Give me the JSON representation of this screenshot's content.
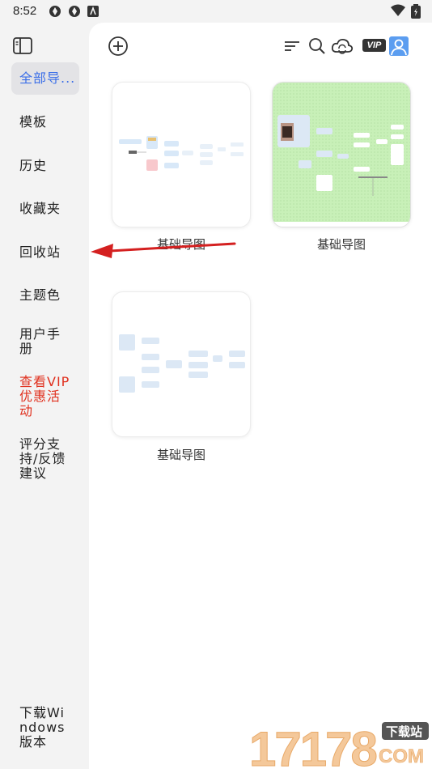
{
  "status": {
    "time": "8:52"
  },
  "sidebar": {
    "items": [
      {
        "label": "全部导...",
        "active": true
      },
      {
        "label": "模板"
      },
      {
        "label": "历史"
      },
      {
        "label": "收藏夹"
      },
      {
        "label": "回收站"
      },
      {
        "label": "主题色"
      },
      {
        "label": "用户手册"
      },
      {
        "label": "查看VIP优惠活动"
      },
      {
        "label": "评分支持/反馈建议"
      },
      {
        "label": "下载Windows版本"
      }
    ]
  },
  "toolbar": {
    "vip_label": "VIP"
  },
  "cards": [
    {
      "title": "基础导图"
    },
    {
      "title": "基础导图"
    },
    {
      "title": "基础导图"
    }
  ],
  "watermark": {
    "digits": "17178",
    "badge": "下载站",
    "domain": "COM"
  },
  "colors": {
    "accent": "#3a6ee8",
    "promo": "#e0301e",
    "annotation_arrow": "#d42020"
  }
}
